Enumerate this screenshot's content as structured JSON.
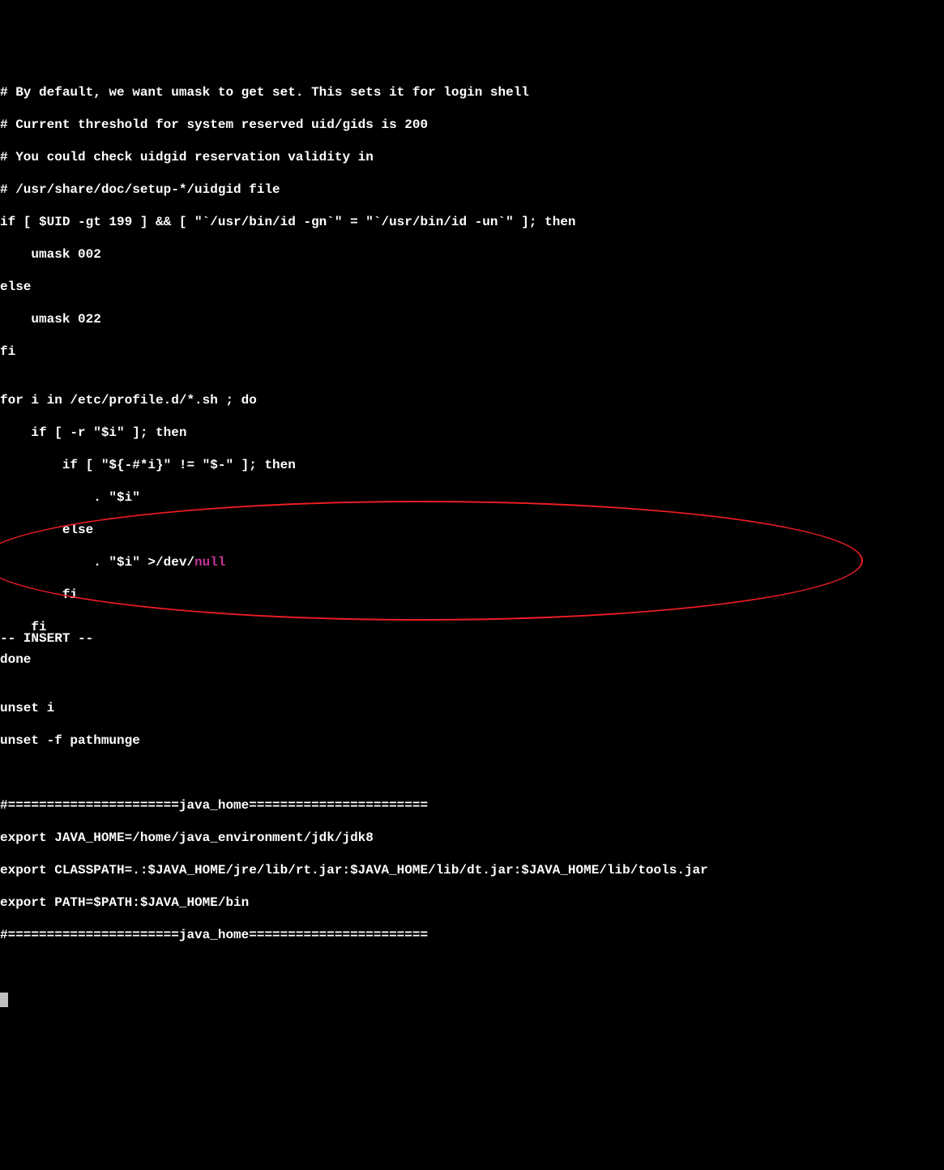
{
  "code": {
    "l1": "# By default, we want umask to get set. This sets it for login shell",
    "l2": "# Current threshold for system reserved uid/gids is 200",
    "l3": "# You could check uidgid reservation validity in",
    "l4": "# /usr/share/doc/setup-*/uidgid file",
    "l5": "if [ $UID -gt 199 ] && [ \"`/usr/bin/id -gn`\" = \"`/usr/bin/id -un`\" ]; then",
    "l6": "    umask 002",
    "l7": "else",
    "l8": "    umask 022",
    "l9": "fi",
    "l10": "",
    "l11": "for i in /etc/profile.d/*.sh ; do",
    "l12": "    if [ -r \"$i\" ]; then",
    "l13": "        if [ \"${-#*i}\" != \"$-\" ]; then",
    "l14": "            . \"$i\"",
    "l15": "        else",
    "l16_prefix": "            . \"$i\" >/dev/",
    "l16_null": "null",
    "l17": "        fi",
    "l18": "    fi",
    "l19": "done",
    "l20": "",
    "l21": "unset i",
    "l22": "unset -f pathmunge",
    "l23": "",
    "l24": "",
    "l25": "#======================java_home=======================",
    "l26": "export JAVA_HOME=/home/java_environment/jdk/jdk8",
    "l27": "export CLASSPATH=.:$JAVA_HOME/jre/lib/rt.jar:$JAVA_HOME/lib/dt.jar:$JAVA_HOME/lib/tools.jar",
    "l28": "export PATH=$PATH:$JAVA_HOME/bin",
    "l29": "#======================java_home======================="
  },
  "mode": "-- INSERT --"
}
